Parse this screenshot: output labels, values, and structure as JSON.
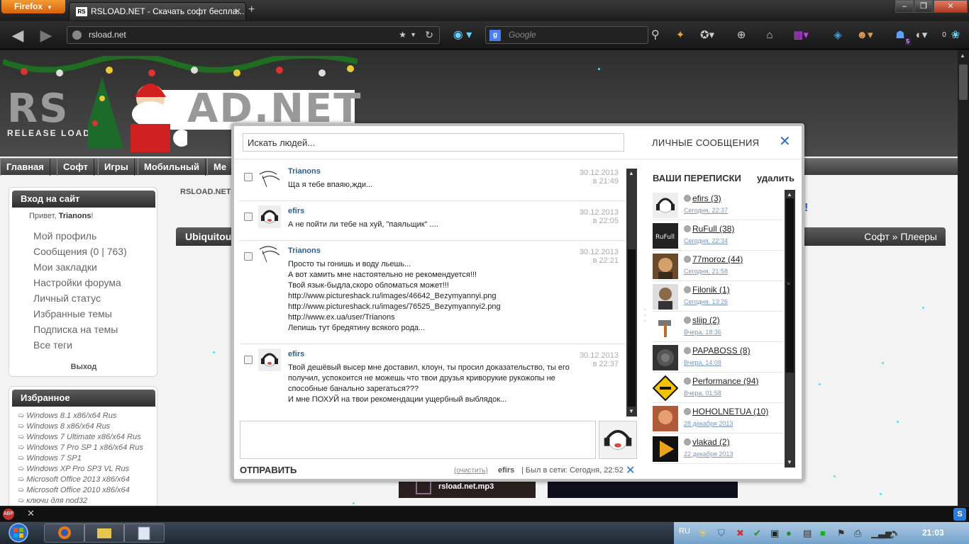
{
  "browser": {
    "app_button": "Firefox",
    "tab_title": "RSLOAD.NET - Скачать софт беспла...",
    "tab_favicon_text": "RS",
    "url": "rsload.net",
    "search_placeholder": "Google",
    "badge_count": "5",
    "counter": "0"
  },
  "site": {
    "logo_part1": "RS",
    "logo_part2": "AD.NET",
    "logo_sub": "RELEASE LOAD",
    "menu": [
      "Главная",
      "Софт",
      "Игры",
      "Мобильный",
      "Ме"
    ],
    "login_box": {
      "title": "Вход на сайт",
      "greeting_prefix": "Привет, ",
      "user": "Trianons",
      "greeting_suffix": "!",
      "links": [
        "Мой профиль",
        "Сообщения (0 | 763)",
        "Мои закладки",
        "Настройки форума",
        "Личный статус",
        "Избранные темы",
        "Подписка на темы",
        "Все теги"
      ],
      "logout": "Выход"
    },
    "favorites": {
      "title": "Избранное",
      "items": [
        "Windows 8.1 x86/x64 Rus",
        "Windows 8 x86/x64 Rus",
        "Windows 7 Ultimate x86/x64 Rus",
        "Windows 7 Pro SP 1 x86/x64 Rus",
        "Windows 7 SP1",
        "Windows XP Pro SP3 VL Rus",
        "Microsoft Office 2013 x86/x64",
        "Microsoft Office 2010 x86/x64",
        "ключи для nod32"
      ]
    },
    "breadcrumb": "RSLOAD.NET",
    "content_title": "Ubiquitou",
    "content_category": "Софт » Плееры",
    "exclamation": "!",
    "mp3_tile": "rsload.net.mp3"
  },
  "modal": {
    "search_placeholder": "Искать людей...",
    "title": "ЛИЧНЫЕ СООБЩЕНИЯ",
    "close": "✕",
    "messages": [
      {
        "author": "Trianons",
        "date": "30.12.2013",
        "time": "в 21:49",
        "lines": [
          "Ща я тебе впаяю,жди..."
        ]
      },
      {
        "author": "efirs",
        "date": "30.12.2013",
        "time": "в 22:05",
        "lines": [
          "А не пойти ли тебе на хуй, \"паяльщик\" ...."
        ]
      },
      {
        "author": "Trianons",
        "date": "30.12.2013",
        "time": "в 22:21",
        "lines": [
          "Просто ты гонишь и воду льешь...",
          "А вот хамить мне настоятельно не рекомендуется!!!",
          "Твой язык-быдла,скоро обломаться может!!!",
          "http://www.pictureshack.ru/images/46642_Bezymyannyi.png",
          "http://www.pictureshack.ru/images/76525_Bezymyannyi2.png",
          "http://www.ex.ua/user/Trianons",
          "Лепишь тут бредятину всякого рода..."
        ]
      },
      {
        "author": "efirs",
        "date": "30.12.2013",
        "time": "в 22:37",
        "lines": [
          "Твой дешёвый высер мне доставил, клоун, ты просил доказательство, ты его получил, успокоится не можешь что твои друзья криворукие рукожопы не способные банально зарегаться???",
          "И мне ПОХУЙ на твои рекомендации ущербный выблядок..."
        ]
      }
    ],
    "send": "ОТПРАВИТЬ",
    "clear": "(очистить)",
    "peer_name": "efirs",
    "peer_status": "| Был в сети: Сегодня, 22:52",
    "conversations_title": "ВАШИ ПЕРЕПИСКИ",
    "delete": "удалить",
    "conversations": [
      {
        "name": " efirs (3)",
        "time": "Сегодня, 22:37"
      },
      {
        "name": " RuFull (38)",
        "time": "Сегодня, 22:34"
      },
      {
        "name": " 77moroz (44)",
        "time": "Сегодня, 21:58"
      },
      {
        "name": " Filonik (1)",
        "time": "Сегодня, 13:26"
      },
      {
        "name": " sliip (2)",
        "time": "Вчера, 18:36"
      },
      {
        "name": " PAPABOSS (8)",
        "time": "Вчера, 14:08"
      },
      {
        "name": " Performance (94)",
        "time": "Вчера, 01:58"
      },
      {
        "name": " HOHOLNETUA (10)",
        "time": "28 декабря 2013"
      },
      {
        "name": " vlakad (2)",
        "time": "22 декабря 2013"
      }
    ]
  },
  "taskbar": {
    "lang": "RU",
    "clock": "21:03"
  },
  "colors": {
    "accent_blue": "#2a6fc9",
    "author_blue": "#2a5f8f",
    "firefox_orange": "#e07b16"
  }
}
